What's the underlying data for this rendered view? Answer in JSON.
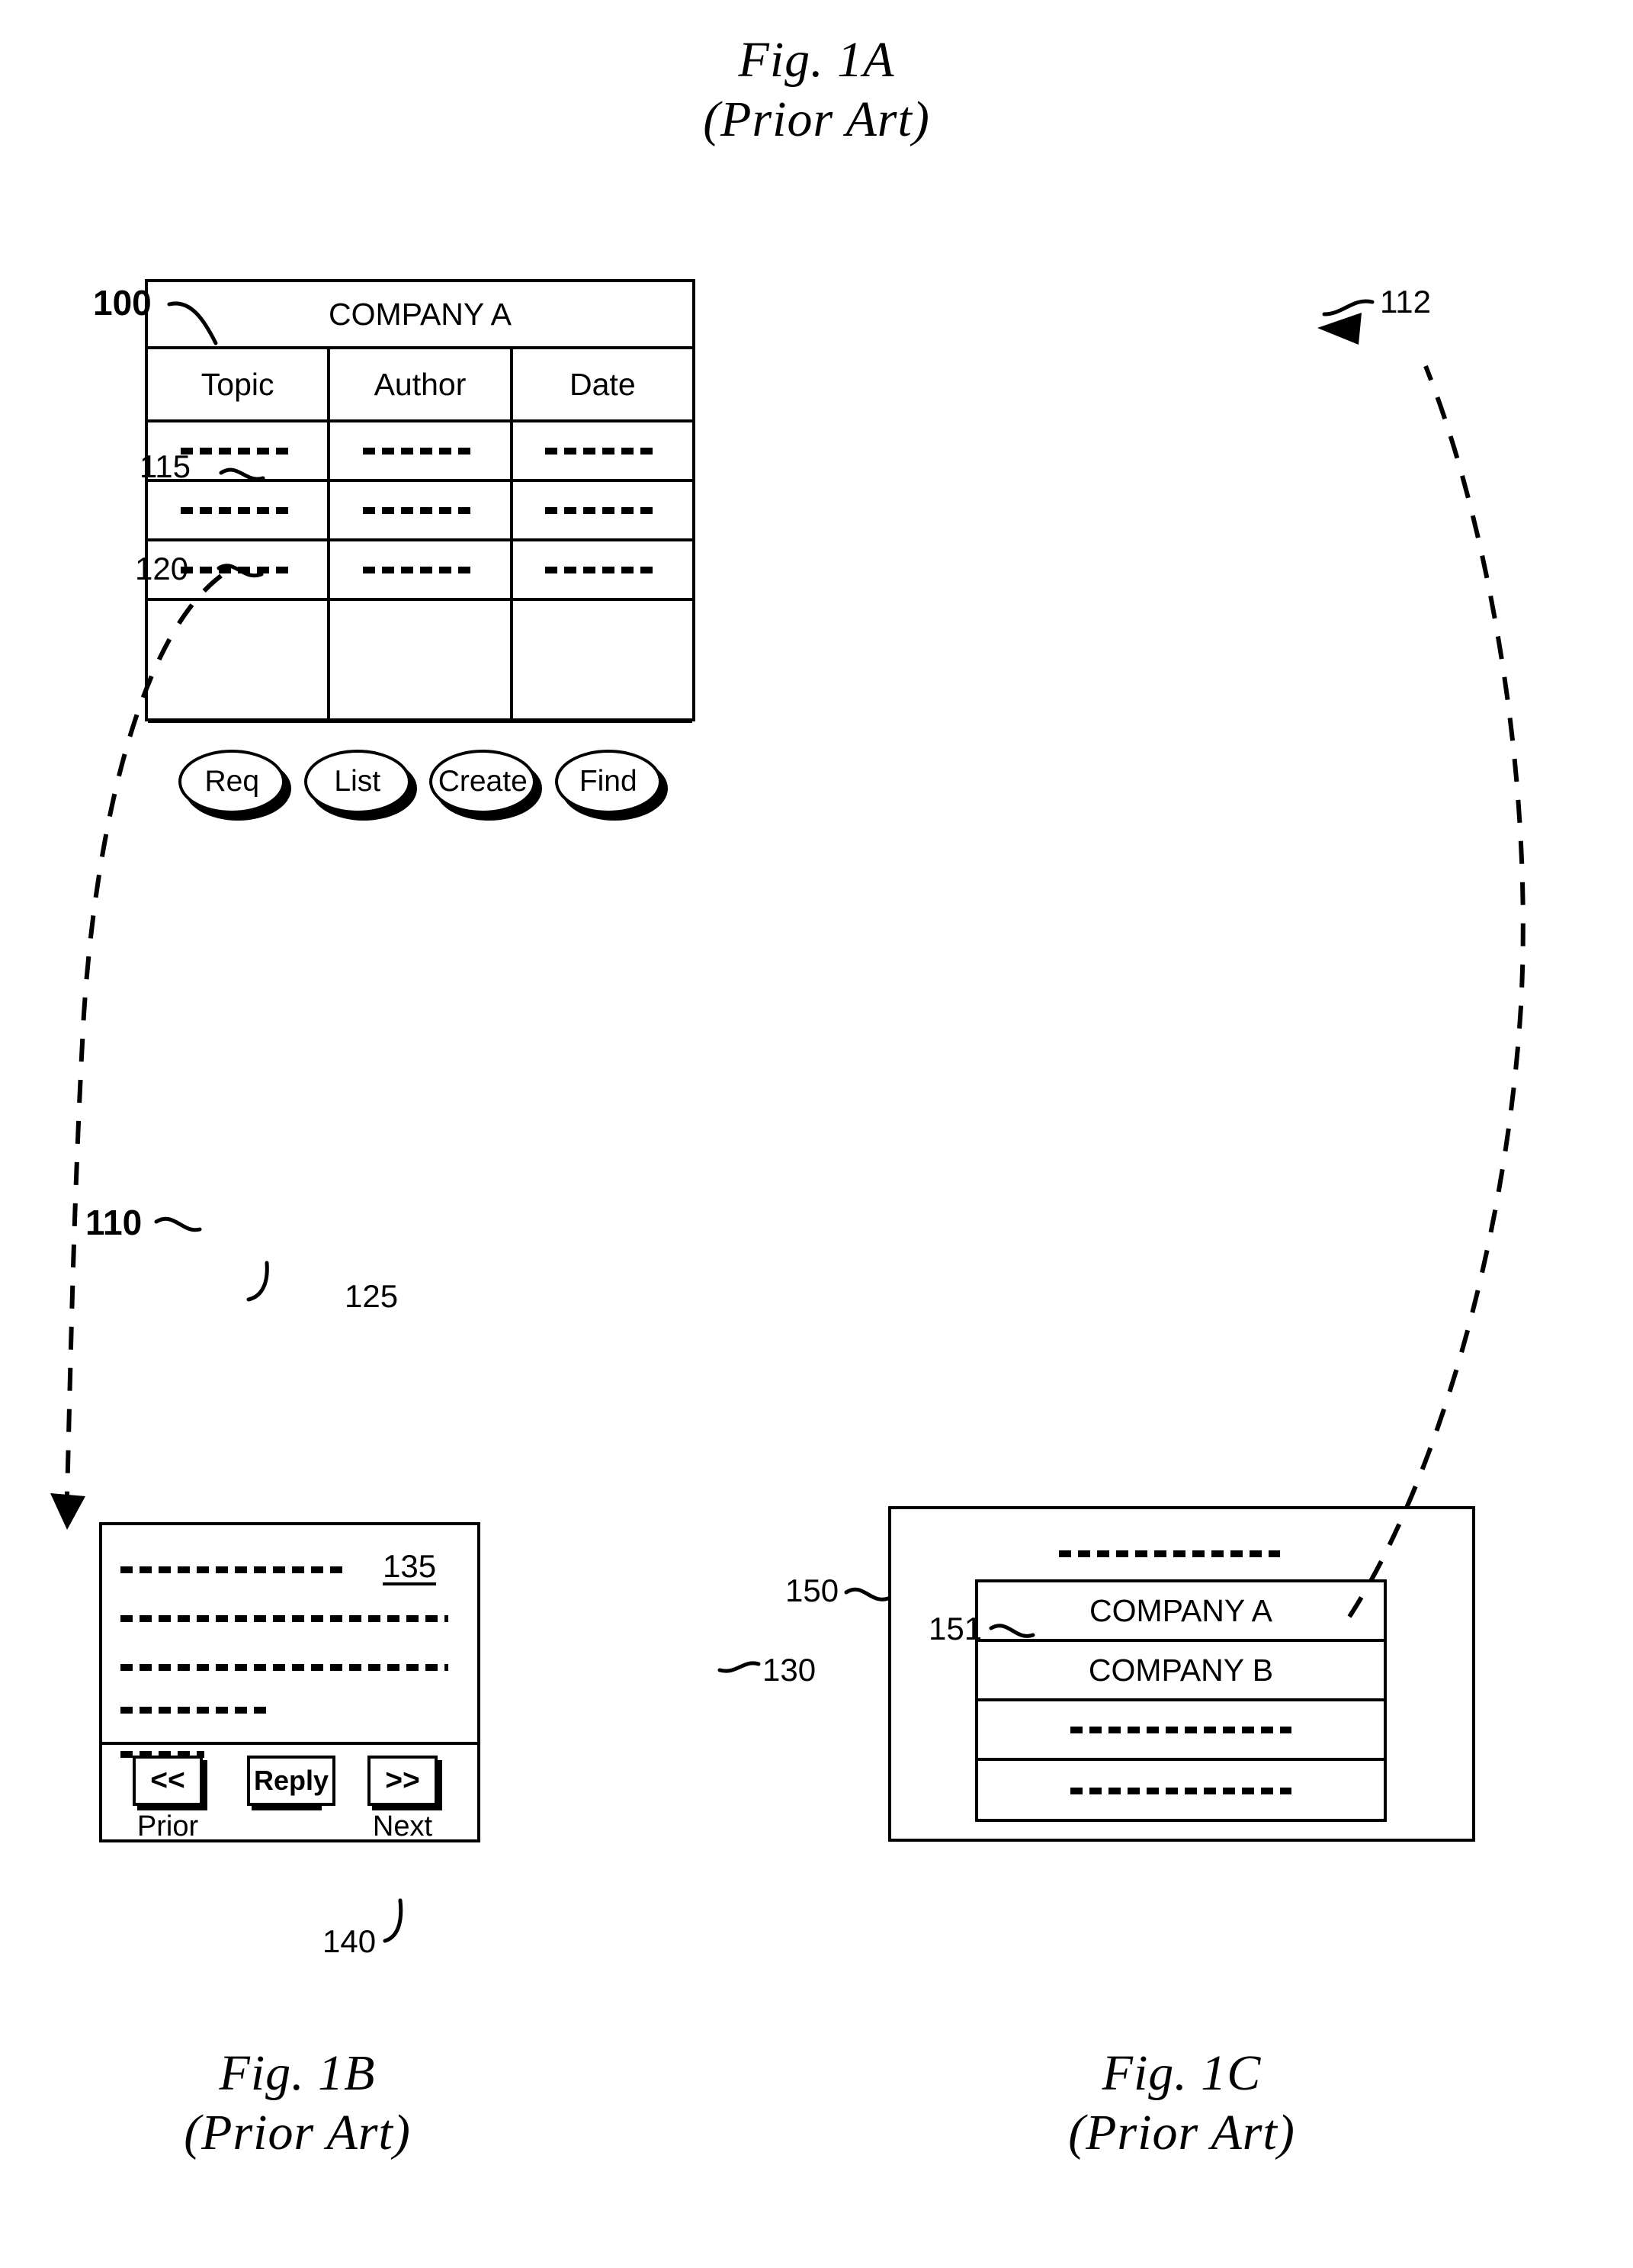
{
  "figures": {
    "fig1a": {
      "caption_line1": "Fig. 1A",
      "caption_line2": "(Prior Art)",
      "window": {
        "title": "COMPANY A",
        "columns": [
          "Topic",
          "Author",
          "Date"
        ],
        "data_rows": [
          [
            "--------------",
            "--------------",
            "--------------"
          ],
          [
            "--------------",
            "--------------",
            "--------------"
          ],
          [
            "--------------",
            "--------------",
            "--------------"
          ]
        ],
        "blank_row": true,
        "buttons": [
          "Req",
          "List",
          "Create",
          "Find"
        ]
      },
      "reference_numerals": {
        "window": "100",
        "title_bar": "112",
        "column_header_row": "115",
        "data_row": "120",
        "button_area": "110",
        "button": "125"
      }
    },
    "fig1b": {
      "caption_line1": "Fig. 1B",
      "caption_line2": "(Prior Art)",
      "window": {
        "message_lines": [
          "-----------------------------",
          "------------------------------------",
          "------------------------------------",
          "----------------",
          "--------"
        ],
        "link_label": "135",
        "buttons": [
          {
            "glyph": "<<",
            "caption": "Prior"
          },
          {
            "glyph": "Reply",
            "caption": ""
          },
          {
            "glyph": ">>",
            "caption": "Next"
          }
        ]
      },
      "reference_numerals": {
        "window": "130",
        "link": "135",
        "reply_button": "140"
      }
    },
    "fig1c": {
      "caption_line1": "Fig. 1C",
      "caption_line2": "(Prior Art)",
      "window": {
        "header_line": "--------------------------",
        "list_items": [
          "COMPANY A",
          "COMPANY B",
          "--------------------------",
          "--------------------------"
        ]
      },
      "reference_numerals": {
        "window": "150",
        "list_item": "151"
      }
    }
  },
  "colors": {
    "ink": "#000000",
    "paper": "#ffffff"
  }
}
